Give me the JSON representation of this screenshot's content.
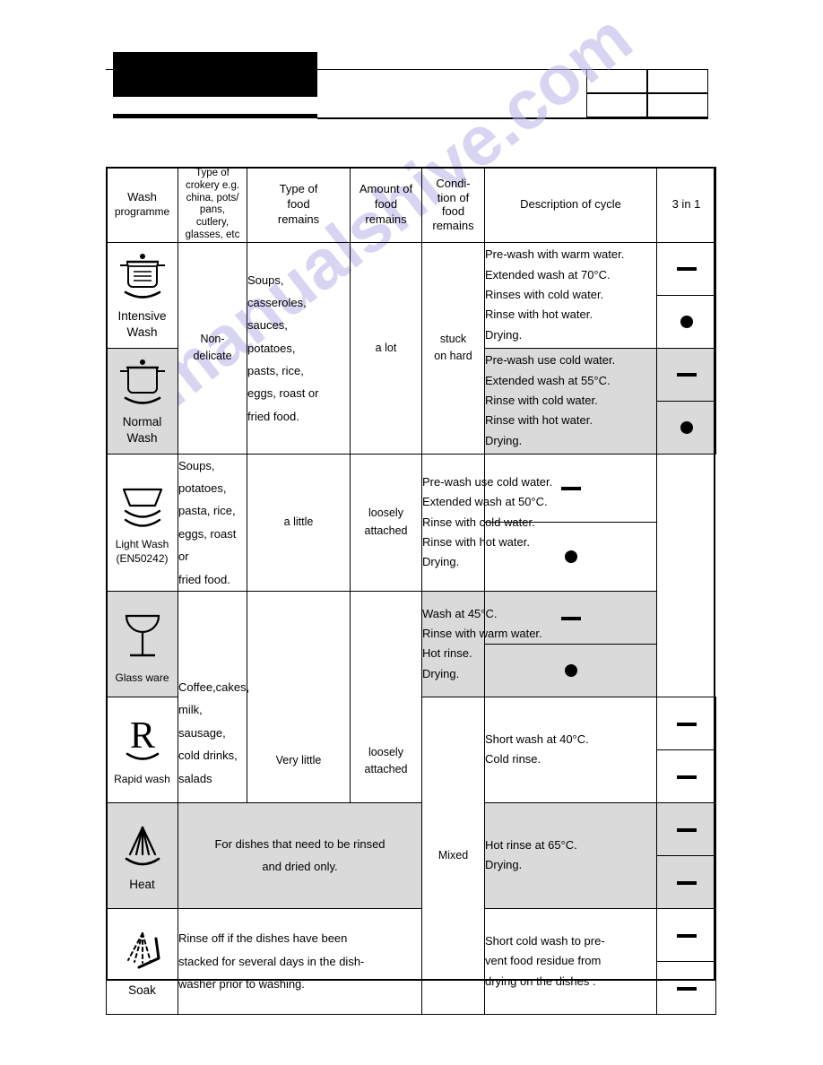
{
  "document": {
    "watermark": "manualshive.com"
  },
  "table": {
    "headers": [
      {
        "id": "wash-programme",
        "lines": [
          "Wash",
          "programme"
        ]
      },
      {
        "id": "type-of-crokery",
        "lines": [
          "Type of",
          "crokery e.g.",
          "china, pots/",
          "pans,",
          "cutlery,",
          "glasses, etc"
        ]
      },
      {
        "id": "type-of-food-remains",
        "lines": [
          "Type of",
          "food",
          "remains"
        ]
      },
      {
        "id": "amount-of-food-remains",
        "lines": [
          "Amount of",
          "food",
          "remains"
        ]
      },
      {
        "id": "condition-of-food-remains",
        "lines": [
          "Condi-",
          "tion of",
          "food",
          "remains"
        ]
      },
      {
        "id": "description-of-cycle",
        "lines": [
          "Description of cycle"
        ]
      },
      {
        "id": "three-in-one",
        "lines": [
          "3 in 1"
        ]
      }
    ],
    "crokery": {
      "non_delicate": [
        "Non-",
        "delicate"
      ],
      "mixed": "Mixed"
    },
    "rows": [
      {
        "programme": {
          "icon": "pot-with-lines-icon",
          "label_lines": [
            "Intensive",
            "Wash"
          ]
        },
        "description": [
          "Pre-wash with warm water.",
          "Extended wash at 70°C.",
          "Rinses with cold water.",
          "Rinse with hot water.",
          "Drying."
        ],
        "three_in_one": [
          "dash",
          "dot"
        ],
        "shaded": false
      },
      {
        "programme": {
          "icon": "pot-empty-icon",
          "label_lines": [
            "Normal",
            "Wash"
          ]
        },
        "description": [
          "Pre-wash use cold water.",
          "Extended wash at 55°C.",
          "Rinse with cold water.",
          "Rinse with hot water.",
          "Drying."
        ],
        "three_in_one": [
          "dash",
          "dot"
        ],
        "shaded": true
      },
      {
        "programme": {
          "icon": "bowl-with-waves-icon",
          "label_lines": [
            "Light Wash",
            "(EN50242)"
          ]
        },
        "description": [
          "Pre-wash use cold water.",
          "Extended wash at 50°C.",
          "Rinse with cold water.",
          "Rinse with hot water.",
          "Drying."
        ],
        "three_in_one": [
          "dash",
          "dot"
        ],
        "shaded": false
      },
      {
        "programme": {
          "icon": "wine-glass-icon",
          "label_lines": [
            "Glass ware"
          ]
        },
        "description": [
          "Wash at 45°C.",
          "Rinse with warm water.",
          "Hot rinse.",
          "Drying."
        ],
        "three_in_one": [
          "dash",
          "dot"
        ],
        "shaded": true
      },
      {
        "programme": {
          "icon": "letter-r-icon",
          "label_lines": [
            "Rapid wash"
          ]
        },
        "description": [
          "Short wash at 40°C.",
          "Cold rinse."
        ],
        "three_in_one": [
          "dash",
          "dash"
        ],
        "shaded": false
      },
      {
        "programme": {
          "icon": "spray-solid-icon",
          "label_lines": [
            "Heat"
          ]
        },
        "description": [
          "Hot rinse at 65°C.",
          "Drying."
        ],
        "three_in_one": [
          "dash",
          "dash"
        ],
        "shaded": true
      },
      {
        "programme": {
          "icon": "spray-dashed-icon",
          "label_lines": [
            "Soak"
          ]
        },
        "description": [
          "Short cold wash to pre-",
          "vent food residue from",
          "drying on the dishes ."
        ],
        "three_in_one": [
          "dash",
          "dash"
        ],
        "shaded": false
      }
    ],
    "groups": {
      "food_heavy": [
        "Soups,",
        "casseroles,",
        "sauces,",
        "potatoes,",
        "pasts, rice,",
        "eggs, roast or",
        "fried food."
      ],
      "food_light": [
        "Soups,",
        "potatoes,",
        "pasta, rice,",
        "eggs, roast or",
        "fried food."
      ],
      "food_rapid": [
        "Coffee,cakes,",
        "milk, sausage,",
        "cold  drinks,",
        "salads"
      ],
      "amount_heavy": "a lot",
      "amount_light": "a little",
      "amount_rapid": "Very little",
      "condition_heavy": [
        "stuck",
        "on hard"
      ],
      "condition_light": [
        "loosely",
        "attached"
      ],
      "condition_rapid": [
        "loosely",
        "attached"
      ],
      "note_heat": [
        "For dishes that need to be rinsed",
        "and dried only."
      ],
      "note_soak": [
        "Rinse off if the dishes have been",
        "stacked for several days in the dish-",
        "washer prior to washing."
      ]
    }
  }
}
